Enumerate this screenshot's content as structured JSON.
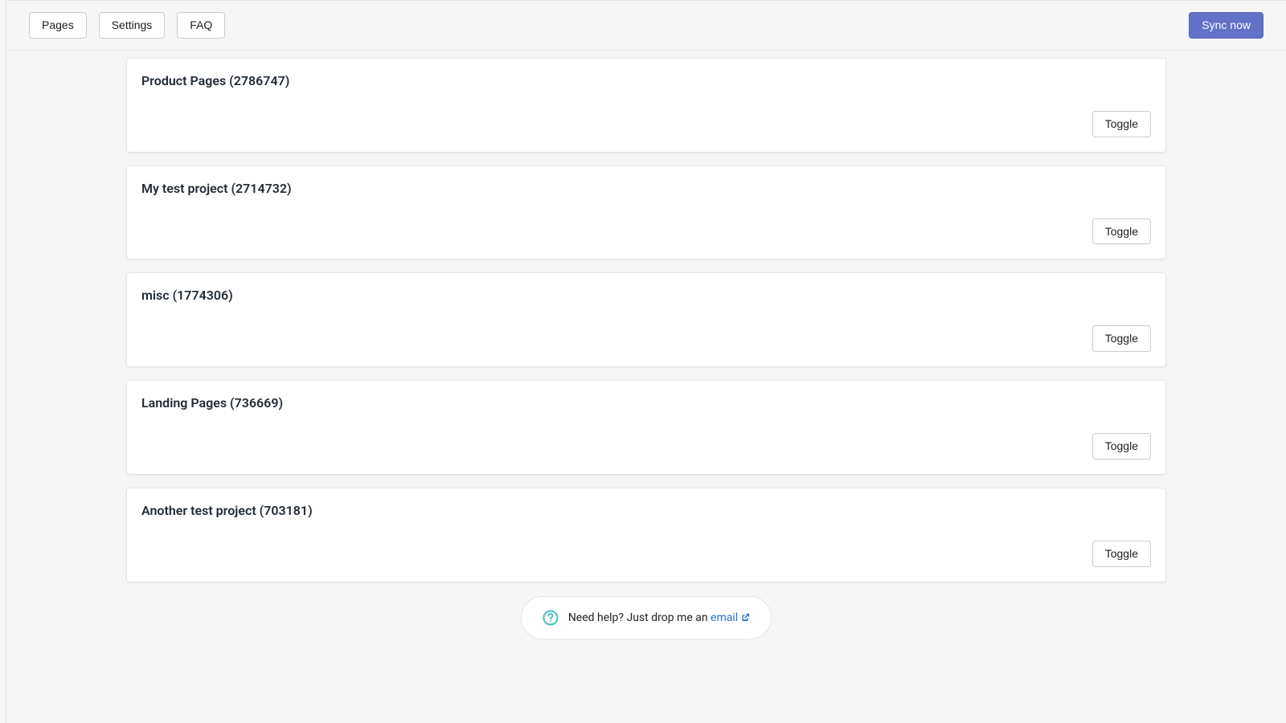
{
  "topbar": {
    "nav": {
      "pages": "Pages",
      "settings": "Settings",
      "faq": "FAQ"
    },
    "sync": "Sync now"
  },
  "items": [
    {
      "title": "Product Pages (2786747)",
      "toggle": "Toggle"
    },
    {
      "title": "My test project (2714732)",
      "toggle": "Toggle"
    },
    {
      "title": "misc (1774306)",
      "toggle": "Toggle"
    },
    {
      "title": "Landing Pages (736669)",
      "toggle": "Toggle"
    },
    {
      "title": "Another test project (703181)",
      "toggle": "Toggle"
    }
  ],
  "help": {
    "text": "Need help? Just drop me an ",
    "link": "email"
  }
}
